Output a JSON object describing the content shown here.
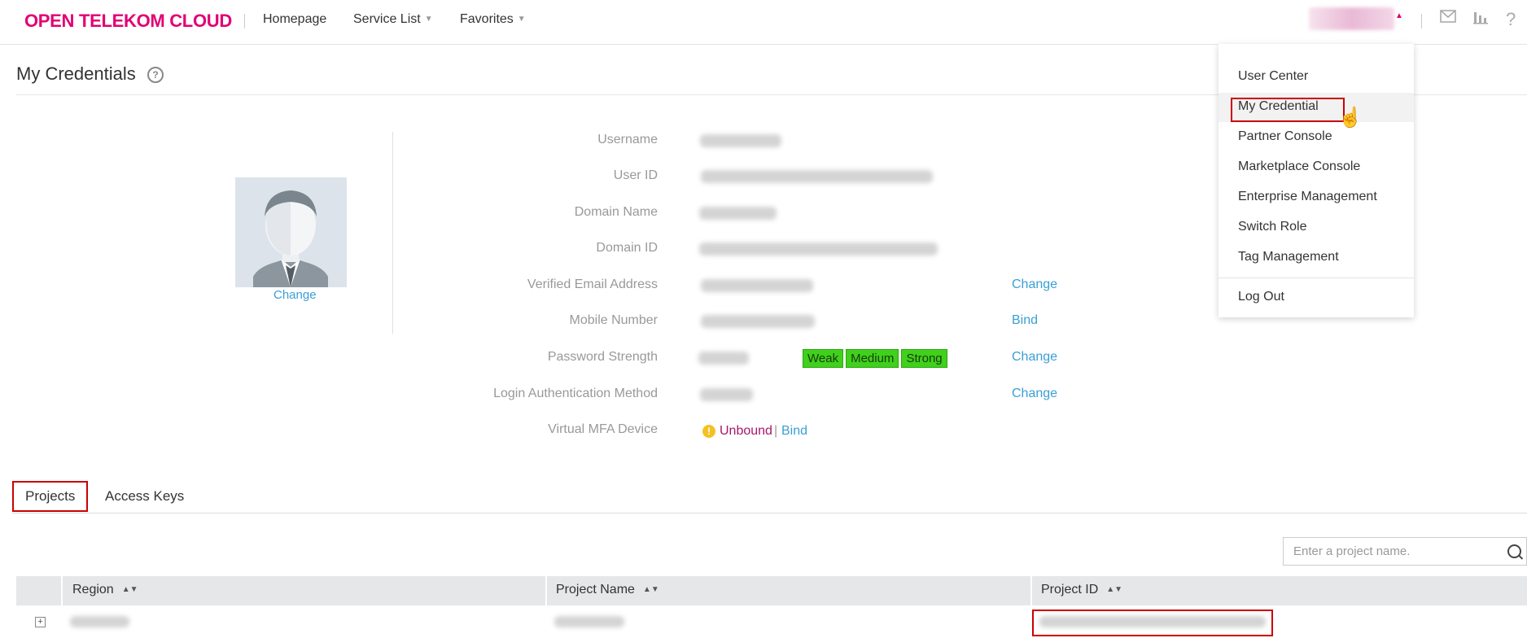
{
  "header": {
    "logo": "OPEN TELEKOM CLOUD",
    "nav": [
      "Homepage",
      "Service List",
      "Favorites"
    ]
  },
  "page": {
    "title": "My Credentials"
  },
  "avatar": {
    "change_label": "Change"
  },
  "fields": [
    {
      "label": "Username",
      "action": ""
    },
    {
      "label": "User ID",
      "action": ""
    },
    {
      "label": "Domain Name",
      "action": ""
    },
    {
      "label": "Domain ID",
      "action": ""
    },
    {
      "label": "Verified Email Address",
      "action": "Change"
    },
    {
      "label": "Mobile Number",
      "action": "Bind"
    },
    {
      "label": "Password Strength",
      "action": "Change"
    },
    {
      "label": "Login Authentication Method",
      "action": "Change"
    },
    {
      "label": "Virtual MFA Device",
      "action": ""
    }
  ],
  "password_strength": {
    "levels": [
      "Weak",
      "Medium",
      "Strong"
    ]
  },
  "mfa": {
    "status": "Unbound",
    "separator": "|",
    "bind_label": "Bind"
  },
  "tabs": [
    "Projects",
    "Access Keys"
  ],
  "search": {
    "placeholder": "Enter a project name."
  },
  "table": {
    "columns": [
      "Region",
      "Project Name",
      "Project ID"
    ]
  },
  "user_menu": {
    "items": [
      "User Center",
      "My Credential",
      "Partner Console",
      "Marketplace Console",
      "Enterprise Management",
      "Switch Role",
      "Tag Management"
    ],
    "logout": "Log Out"
  },
  "colors": {
    "brand": "#e20074",
    "link": "#3a9fd6",
    "strength": "#3fd11b",
    "highlight": "#cc0000"
  }
}
